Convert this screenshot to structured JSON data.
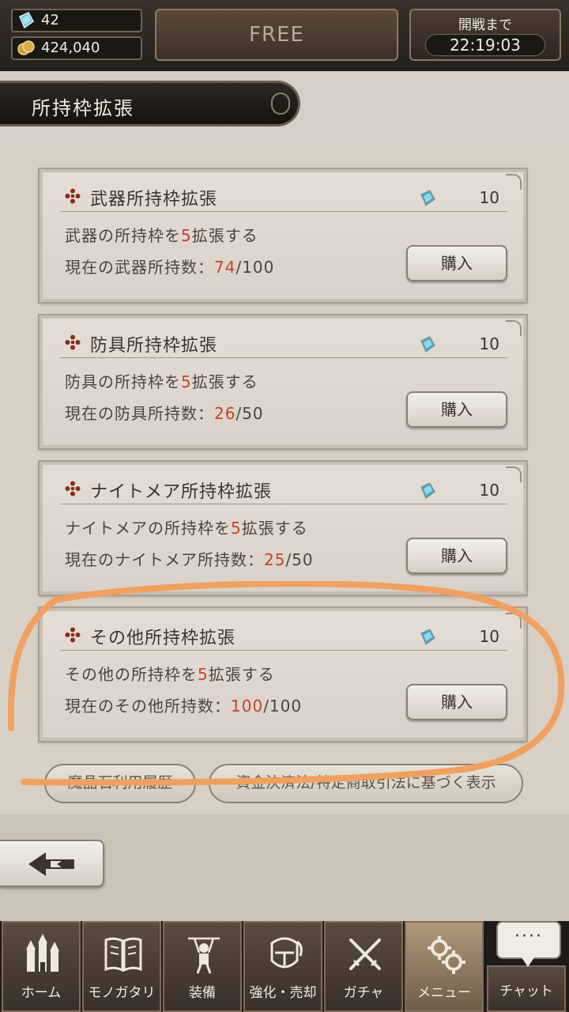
{
  "header": {
    "gems": "42",
    "coins": "424,040",
    "free_label": "FREE",
    "battle_label": "開戦まで",
    "battle_timer": "22:19:03"
  },
  "page_title": "所持枠拡張",
  "cards": [
    {
      "title": "武器所持枠拡張",
      "cost": "10",
      "desc_pre": "武器の所持枠を",
      "desc_num": "5",
      "desc_post": "拡張する",
      "count_pre": "現在の武器所持数：",
      "count_cur": "74",
      "count_max": "/100",
      "buy": "購入"
    },
    {
      "title": "防具所持枠拡張",
      "cost": "10",
      "desc_pre": "防具の所持枠を",
      "desc_num": "5",
      "desc_post": "拡張する",
      "count_pre": "現在の防具所持数：",
      "count_cur": "26",
      "count_max": "/50",
      "buy": "購入"
    },
    {
      "title": "ナイトメア所持枠拡張",
      "cost": "10",
      "desc_pre": "ナイトメアの所持枠を",
      "desc_num": "5",
      "desc_post": "拡張する",
      "count_pre": "現在のナイトメア所持数：",
      "count_cur": "25",
      "count_max": "/50",
      "buy": "購入"
    },
    {
      "title": "その他所持枠拡張",
      "cost": "10",
      "desc_pre": "その他の所持枠を",
      "desc_num": "5",
      "desc_post": "拡張する",
      "count_pre": "現在のその他所持数：",
      "count_cur": "100",
      "count_max": "/100",
      "buy": "購入"
    }
  ],
  "footer_buttons": {
    "history": "魔晶石利用履歴",
    "law": "資金決済法/特定商取引法に基づく表示"
  },
  "nav": {
    "home": "ホーム",
    "story": "モノガタリ",
    "equip": "装備",
    "enhance": "強化・売却",
    "gacha": "ガチャ",
    "menu": "メニュー",
    "chat": "チャット",
    "chat_bubble": "····"
  },
  "colors": {
    "accent_red": "#c4442c",
    "annotation_orange": "#f0a060"
  }
}
